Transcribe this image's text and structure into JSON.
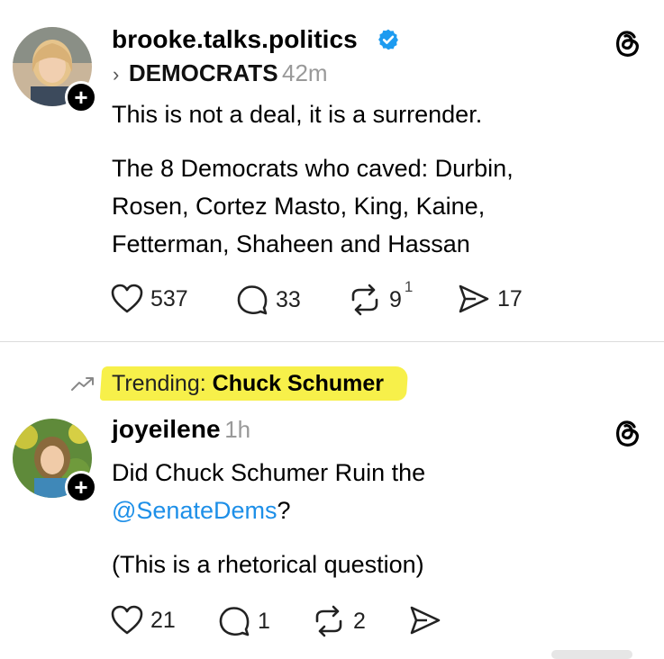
{
  "posts": [
    {
      "username": "brooke.talks.politics",
      "verified": true,
      "community": "DEMOCRATS",
      "time": "42m",
      "line1": "This is not a deal, it is a surrender.",
      "line2": "The 8 Democrats who caved: Durbin,",
      "line3": "Rosen, Cortez Masto, King, Kaine,",
      "line4": "Fetterman, Shaheen and Hassan",
      "likes": "537",
      "replies": "33",
      "reposts": "9",
      "reposts_sup": "1",
      "shares": "17"
    },
    {
      "trending_prefix": "Trending: ",
      "trending_topic": "Chuck Schumer",
      "username": "joyeilene",
      "time": "1h",
      "line1": "Did Chuck Schumer Ruin the",
      "mention": "@SenateDems",
      "mention_suffix": "?",
      "line3": "(This is a rhetorical question)",
      "likes": "21",
      "replies": "1",
      "reposts": "2"
    }
  ],
  "icons": {
    "verified": "verified-badge-icon",
    "threads": "threads-logo-icon",
    "like": "heart-icon",
    "reply": "comment-icon",
    "repost": "repost-icon",
    "share": "send-icon",
    "trending": "trending-arrow-icon",
    "follow": "plus-icon"
  },
  "colors": {
    "verified": "#1d9bf0",
    "mention": "#1d8fe8",
    "trending_highlight": "#f7f04a"
  }
}
